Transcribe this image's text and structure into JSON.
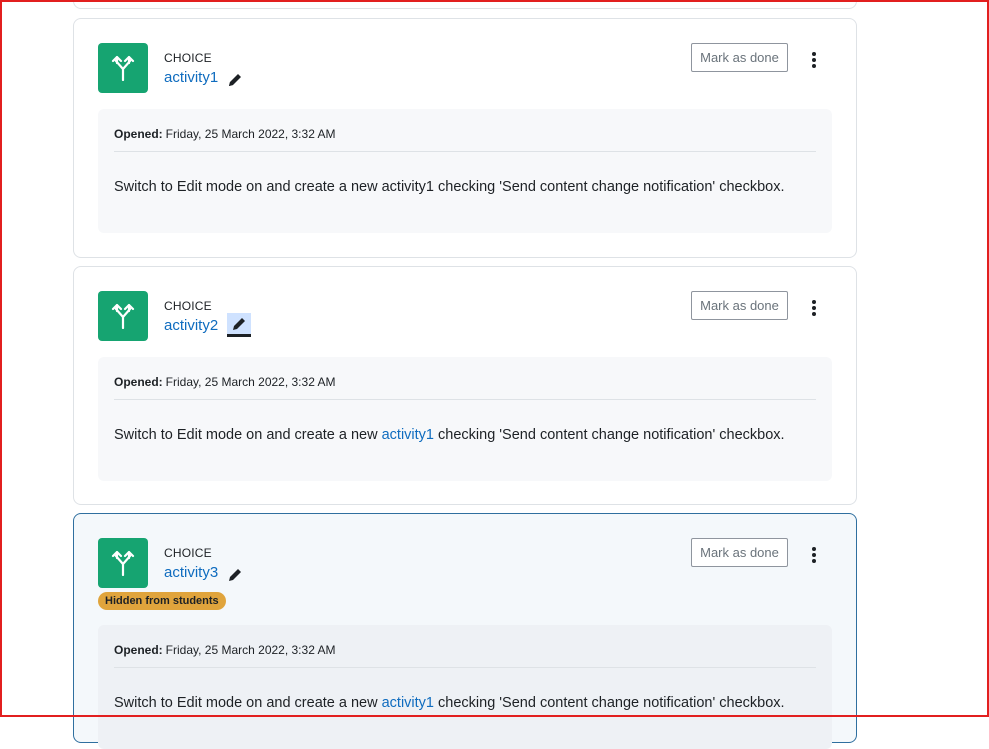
{
  "activities": [
    {
      "modtype": "CHOICE",
      "name": "activity1",
      "mark_label": "Mark as done",
      "opened_label": "Opened:",
      "opened_value": "Friday, 25 March 2022, 3:32 AM",
      "desc_before": "Switch to Edit mode on and create a new activity1 checking 'Send content change notification' checkbox.",
      "desc_link": "",
      "desc_after": ""
    },
    {
      "modtype": "CHOICE",
      "name": "activity2",
      "mark_label": "Mark as done",
      "opened_label": "Opened:",
      "opened_value": "Friday, 25 March 2022, 3:32 AM",
      "desc_before": "Switch to Edit mode on and create a new ",
      "desc_link": "activity1",
      "desc_after": " checking 'Send content change notification' checkbox."
    },
    {
      "modtype": "CHOICE",
      "name": "activity3",
      "badge": "Hidden from students",
      "mark_label": "Mark as done",
      "opened_label": "Opened:",
      "opened_value": "Friday, 25 March 2022, 3:32 AM",
      "desc_before": "Switch to Edit mode on and create a new ",
      "desc_link": "activity1",
      "desc_after": " checking 'Send content change notification' checkbox."
    }
  ],
  "colors": {
    "icon_bg": "#16a471",
    "link": "#0f6cbf",
    "badge_bg": "#e0a43c",
    "frame": "#e21f1f"
  },
  "icons": {
    "activity": "choice-icon",
    "edit": "pencil-icon",
    "menu": "kebab-menu-icon"
  }
}
